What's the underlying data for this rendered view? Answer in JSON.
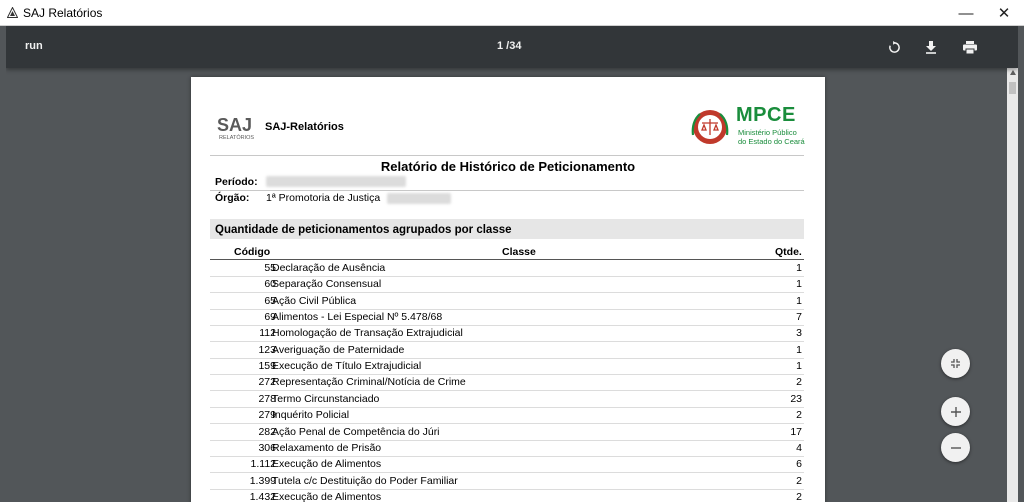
{
  "window": {
    "title": "SAJ Relatórios",
    "minimize_label": "—",
    "close_label": "✕"
  },
  "toolbar": {
    "file_title": "run",
    "page_count": "1 /34"
  },
  "header": {
    "app_name": "SAJ-Relatórios",
    "logo_text": "SAJ",
    "logo_sub": "RELATÓRIOS",
    "org_name": "MPCE",
    "org_sub1": "Ministério Público",
    "org_sub2": "do Estado do Ceará"
  },
  "report": {
    "title": "Relatório de Histórico de Peticionamento",
    "period_label": "Período:",
    "organ_label": "Órgão:",
    "organ_value": "1ª Promotoria de Justiça",
    "section_title": "Quantidade de peticionamentos agrupados por classe",
    "columns": {
      "code": "Código",
      "class": "Classe",
      "qty": "Qtde."
    },
    "rows": [
      {
        "code": "55",
        "class": "Declaração de Ausência",
        "qty": "1"
      },
      {
        "code": "60",
        "class": "Separação Consensual",
        "qty": "1"
      },
      {
        "code": "65",
        "class": "Ação Civil Pública",
        "qty": "1"
      },
      {
        "code": "69",
        "class": "Alimentos - Lei Especial Nº 5.478/68",
        "qty": "7"
      },
      {
        "code": "112",
        "class": "Homologação de Transação Extrajudicial",
        "qty": "3"
      },
      {
        "code": "123",
        "class": "Averiguação de Paternidade",
        "qty": "1"
      },
      {
        "code": "159",
        "class": "Execução de Título Extrajudicial",
        "qty": "1"
      },
      {
        "code": "272",
        "class": "Representação Criminal/Notícia de Crime",
        "qty": "2"
      },
      {
        "code": "278",
        "class": "Termo Circunstanciado",
        "qty": "23"
      },
      {
        "code": "279",
        "class": "Inquérito Policial",
        "qty": "2"
      },
      {
        "code": "282",
        "class": "Ação Penal de Competência do Júri",
        "qty": "17"
      },
      {
        "code": "306",
        "class": "Relaxamento de Prisão",
        "qty": "4"
      },
      {
        "code": "1.112",
        "class": "Execução de Alimentos",
        "qty": "6"
      },
      {
        "code": "1.399",
        "class": "Tutela c/c Destituição do Poder Familiar",
        "qty": "2"
      },
      {
        "code": "1.432",
        "class": "Execução de Alimentos",
        "qty": "2"
      }
    ]
  },
  "icons": {
    "rotate": "rotate-icon",
    "download": "download-icon",
    "print": "print-icon",
    "fit": "fit-page-icon",
    "zoom_in": "zoom-in-icon",
    "zoom_out": "zoom-out-icon"
  },
  "colors": {
    "mpce_green": "#1a8d3c",
    "mpce_red": "#c0392b",
    "toolbar": "#323639",
    "viewer_bg": "#525659"
  }
}
